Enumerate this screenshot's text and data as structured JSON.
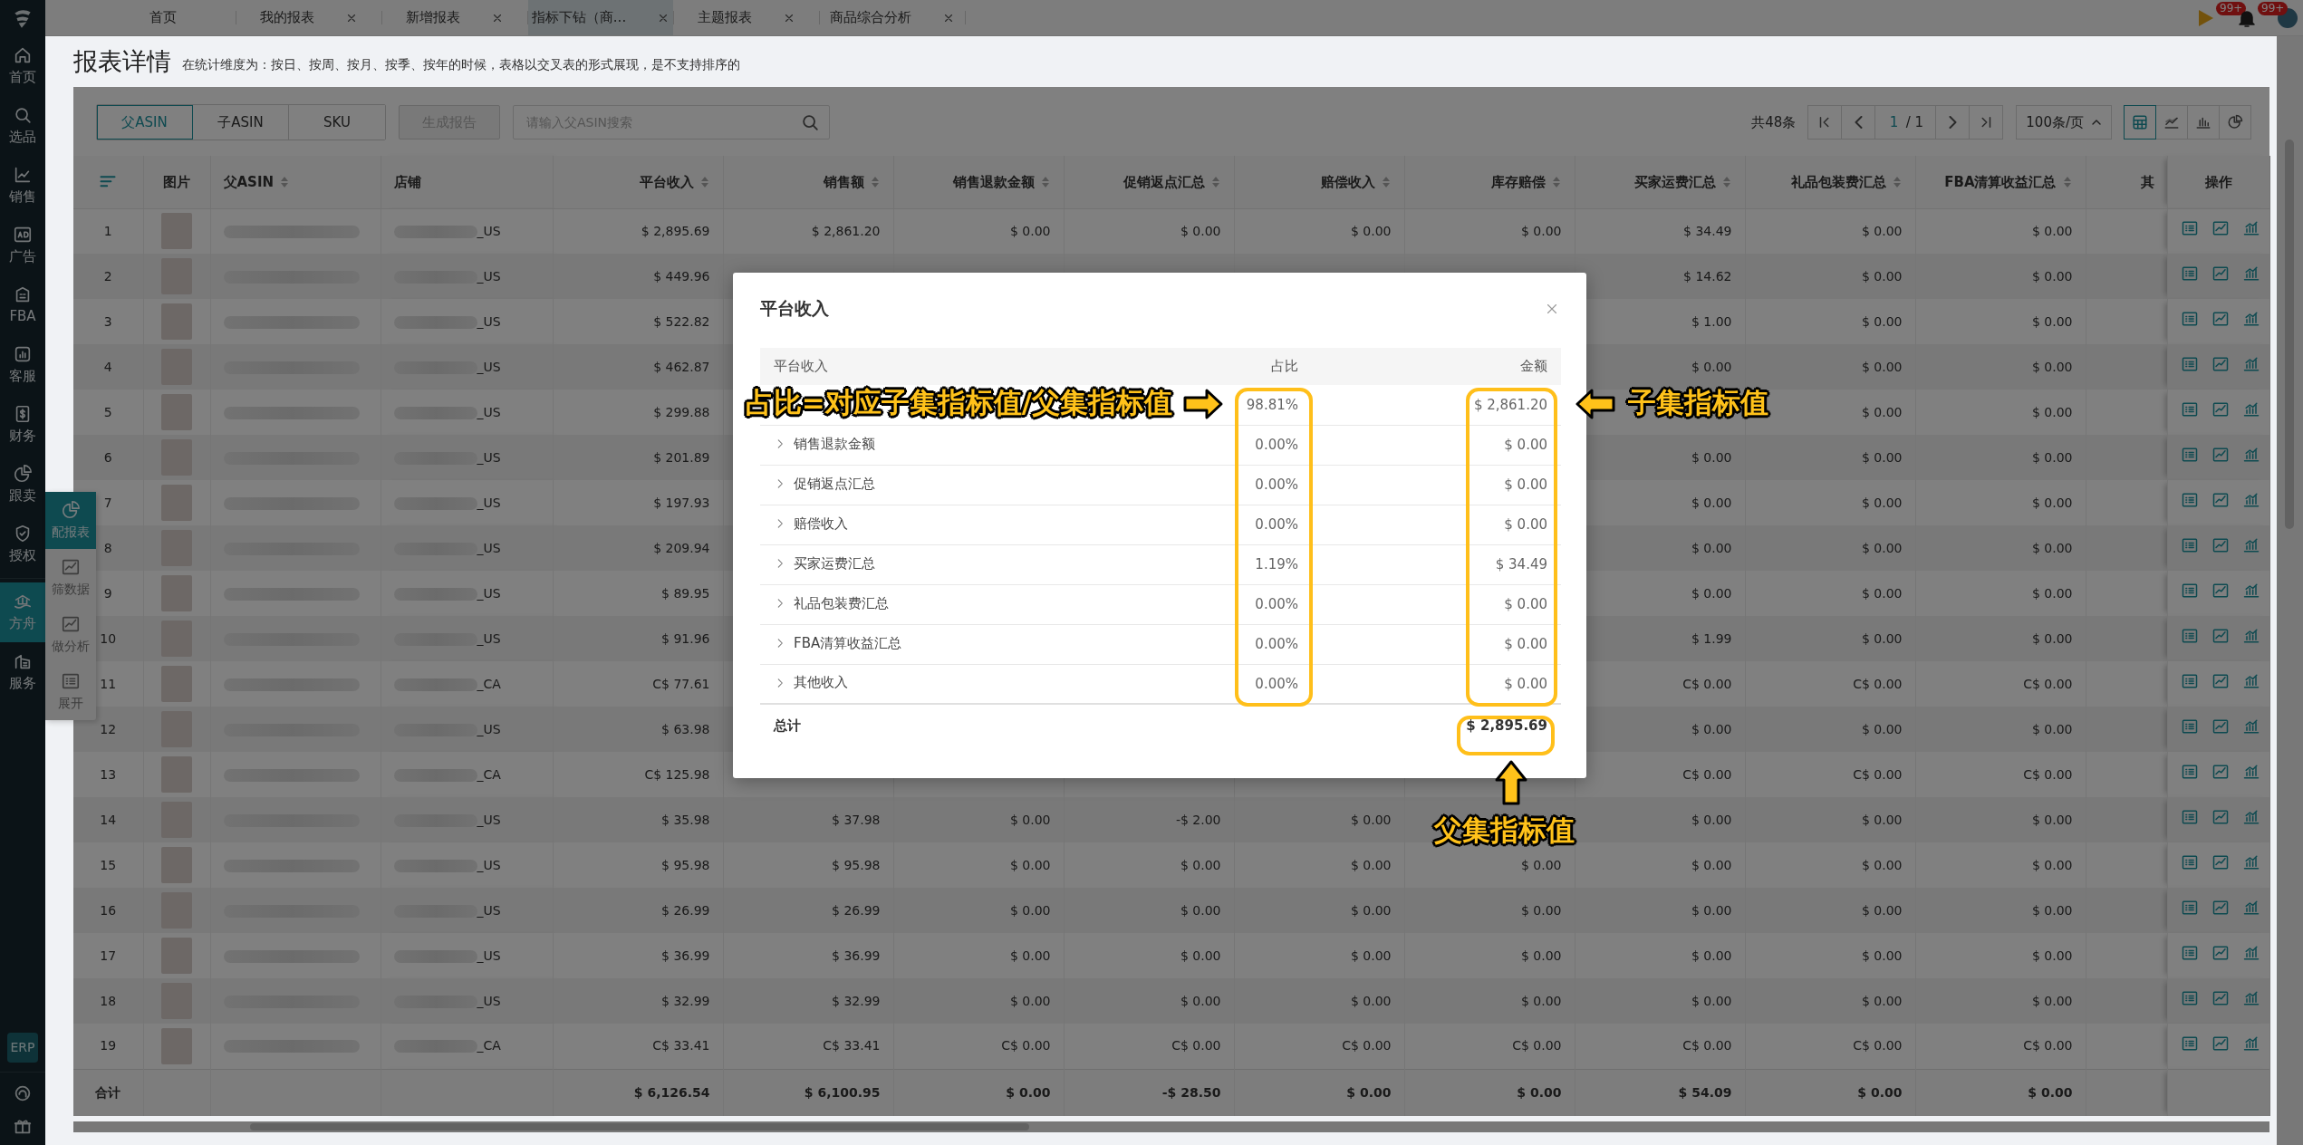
{
  "sidebar": {
    "items": [
      {
        "label": "首页",
        "selected": false
      },
      {
        "label": "选品",
        "selected": false
      },
      {
        "label": "销售",
        "selected": false
      },
      {
        "label": "广告",
        "selected": false
      },
      {
        "label": "FBA",
        "selected": false
      },
      {
        "label": "客服",
        "selected": false
      },
      {
        "label": "财务",
        "selected": false
      },
      {
        "label": "跟卖",
        "selected": false
      },
      {
        "label": "授权",
        "selected": false
      },
      {
        "label": "方舟",
        "selected": true
      },
      {
        "label": "服务",
        "selected": false
      }
    ],
    "badge": "ERP"
  },
  "flyout": {
    "items": [
      {
        "label": "配报表",
        "selected": true
      },
      {
        "label": "筛数据",
        "selected": false
      },
      {
        "label": "做分析",
        "selected": false
      },
      {
        "label": "展开",
        "selected": false
      }
    ]
  },
  "tabs": [
    {
      "label": "首页",
      "closable": false,
      "selected": false
    },
    {
      "label": "我的报表",
      "closable": true,
      "selected": false
    },
    {
      "label": "新增报表",
      "closable": true,
      "selected": false
    },
    {
      "label": "指标下钻（商...",
      "closable": true,
      "selected": true
    },
    {
      "label": "主题报表",
      "closable": true,
      "selected": false
    },
    {
      "label": "商品综合分析",
      "closable": true,
      "selected": false
    }
  ],
  "notifications": [
    {
      "kind": "flag",
      "count": "99+"
    },
    {
      "kind": "bell",
      "count": "99+"
    }
  ],
  "page": {
    "title": "报表详情",
    "hint": "在统计维度为：按日、按周、按月、按季、按年的时候，表格以交叉表的形式展现，是不支持排序的"
  },
  "toolbar": {
    "segments": [
      {
        "label": "父ASIN",
        "selected": true
      },
      {
        "label": "子ASIN",
        "selected": false
      },
      {
        "label": "SKU",
        "selected": false
      }
    ],
    "generate_button": {
      "label": "生成报告",
      "disabled": true
    },
    "search": {
      "placeholder": "请输入父ASIN搜索"
    }
  },
  "pagination": {
    "total": "共48条",
    "page": "1",
    "pages": "/ 1",
    "page_size": "100条/页"
  },
  "views": [
    {
      "kind": "table",
      "selected": true
    },
    {
      "kind": "line",
      "selected": false
    },
    {
      "kind": "bar",
      "selected": false
    },
    {
      "kind": "pie",
      "selected": false
    }
  ],
  "table": {
    "columns": [
      {
        "label": "图片",
        "kind": "image",
        "sortable": false
      },
      {
        "label": "父ASIN",
        "kind": "text",
        "sortable": true
      },
      {
        "label": "店铺",
        "kind": "shop",
        "sortable": false
      },
      {
        "label": "平台收入",
        "kind": "money",
        "sortable": true
      },
      {
        "label": "销售额",
        "kind": "money",
        "sortable": true
      },
      {
        "label": "销售退款金额",
        "kind": "money",
        "sortable": true
      },
      {
        "label": "促销返点汇总",
        "kind": "money",
        "sortable": true
      },
      {
        "label": "赔偿收入",
        "kind": "money",
        "sortable": true
      },
      {
        "label": "库存赔偿",
        "kind": "money",
        "sortable": true
      },
      {
        "label": "买家运费汇总",
        "kind": "money",
        "sortable": true
      },
      {
        "label": "礼品包装费汇总",
        "kind": "money",
        "sortable": true
      },
      {
        "label": "FBA清算收益汇总",
        "kind": "money",
        "sortable": true
      },
      {
        "label": "其",
        "kind": "cut",
        "sortable": false
      },
      {
        "label": "操作",
        "kind": "actions",
        "sortable": false
      }
    ],
    "rows": [
      {
        "index": "1",
        "market": "_US",
        "cells": {
          "platform_income": "$ 2,895.69",
          "sales": "$ 2,861.20",
          "refund": "$ 0.00",
          "promo_rebate": "$ 0.00",
          "compensation": "$ 0.00",
          "inventory_comp": "$ 0.00",
          "buyer_shipping": "$ 34.49",
          "gift_wrap": "$ 0.00",
          "fba_liquidation": "$ 0.00"
        }
      },
      {
        "index": "2",
        "market": "_US",
        "cells": {
          "platform_income": "$ 449.96",
          "buyer_shipping": "$ 14.62",
          "gift_wrap": "$ 0.00",
          "fba_liquidation": "$ 0.00"
        }
      },
      {
        "index": "3",
        "market": "_US",
        "cells": {
          "platform_income": "$ 522.82",
          "buyer_shipping": "$ 1.00",
          "gift_wrap": "$ 0.00",
          "fba_liquidation": "$ 0.00"
        }
      },
      {
        "index": "4",
        "market": "_US",
        "cells": {
          "platform_income": "$ 462.87",
          "buyer_shipping": "$ 0.00",
          "gift_wrap": "$ 0.00",
          "fba_liquidation": "$ 0.00"
        }
      },
      {
        "index": "5",
        "market": "_US",
        "cells": {
          "platform_income": "$ 299.88",
          "gift_wrap": "$ 0.00",
          "fba_liquidation": "$ 0.00"
        }
      },
      {
        "index": "6",
        "market": "_US",
        "cells": {
          "platform_income": "$ 201.89",
          "buyer_shipping": "$ 0.00",
          "gift_wrap": "$ 0.00",
          "fba_liquidation": "$ 0.00"
        }
      },
      {
        "index": "7",
        "market": "_US",
        "cells": {
          "platform_income": "$ 197.93",
          "buyer_shipping": "$ 0.00",
          "gift_wrap": "$ 0.00",
          "fba_liquidation": "$ 0.00"
        }
      },
      {
        "index": "8",
        "market": "_US",
        "cells": {
          "platform_income": "$ 209.94",
          "buyer_shipping": "$ 0.00",
          "gift_wrap": "$ 0.00",
          "fba_liquidation": "$ 0.00"
        }
      },
      {
        "index": "9",
        "market": "_US",
        "cells": {
          "platform_income": "$ 89.95",
          "buyer_shipping": "$ 0.00",
          "gift_wrap": "$ 0.00",
          "fba_liquidation": "$ 0.00"
        }
      },
      {
        "index": "10",
        "market": "_US",
        "cells": {
          "platform_income": "$ 91.96",
          "buyer_shipping": "$ 1.99",
          "gift_wrap": "$ 0.00",
          "fba_liquidation": "$ 0.00"
        }
      },
      {
        "index": "11",
        "market": "_CA",
        "cells": {
          "platform_income": "C$ 77.61",
          "buyer_shipping": "C$ 0.00",
          "gift_wrap": "C$ 0.00",
          "fba_liquidation": "C$ 0.00"
        }
      },
      {
        "index": "12",
        "market": "_US",
        "cells": {
          "platform_income": "$ 63.98",
          "buyer_shipping": "$ 0.00",
          "gift_wrap": "$ 0.00",
          "fba_liquidation": "$ 0.00"
        }
      },
      {
        "index": "13",
        "market": "_CA",
        "cells": {
          "platform_income": "C$ 125.98",
          "buyer_shipping": "C$ 0.00",
          "gift_wrap": "C$ 0.00",
          "fba_liquidation": "C$ 0.00"
        }
      },
      {
        "index": "14",
        "market": "_US",
        "cells": {
          "platform_income": "$ 35.98",
          "sales": "$ 37.98",
          "refund": "$ 0.00",
          "promo_rebate": "-$ 2.00",
          "compensation": "$ 0.00",
          "buyer_shipping": "$ 0.00",
          "gift_wrap": "$ 0.00",
          "fba_liquidation": "$ 0.00"
        }
      },
      {
        "index": "15",
        "market": "_US",
        "cells": {
          "platform_income": "$ 95.98",
          "sales": "$ 95.98",
          "refund": "$ 0.00",
          "promo_rebate": "$ 0.00",
          "compensation": "$ 0.00",
          "inventory_comp": "$ 0.00",
          "buyer_shipping": "$ 0.00",
          "gift_wrap": "$ 0.00",
          "fba_liquidation": "$ 0.00"
        }
      },
      {
        "index": "16",
        "market": "_US",
        "cells": {
          "platform_income": "$ 26.99",
          "sales": "$ 26.99",
          "refund": "$ 0.00",
          "promo_rebate": "$ 0.00",
          "compensation": "$ 0.00",
          "inventory_comp": "$ 0.00",
          "buyer_shipping": "$ 0.00",
          "gift_wrap": "$ 0.00",
          "fba_liquidation": "$ 0.00"
        }
      },
      {
        "index": "17",
        "market": "_US",
        "cells": {
          "platform_income": "$ 36.99",
          "sales": "$ 36.99",
          "refund": "$ 0.00",
          "promo_rebate": "$ 0.00",
          "compensation": "$ 0.00",
          "inventory_comp": "$ 0.00",
          "buyer_shipping": "$ 0.00",
          "gift_wrap": "$ 0.00",
          "fba_liquidation": "$ 0.00"
        }
      },
      {
        "index": "18",
        "market": "_US",
        "cells": {
          "platform_income": "$ 32.99",
          "sales": "$ 32.99",
          "refund": "$ 0.00",
          "promo_rebate": "$ 0.00",
          "compensation": "$ 0.00",
          "inventory_comp": "$ 0.00",
          "buyer_shipping": "$ 0.00",
          "gift_wrap": "$ 0.00",
          "fba_liquidation": "$ 0.00"
        }
      },
      {
        "index": "19",
        "market": "_CA",
        "cells": {
          "platform_income": "C$ 33.41",
          "sales": "C$ 33.41",
          "refund": "C$ 0.00",
          "promo_rebate": "C$ 0.00",
          "compensation": "C$ 0.00",
          "inventory_comp": "C$ 0.00",
          "buyer_shipping": "C$ 0.00",
          "gift_wrap": "C$ 0.00",
          "fba_liquidation": "C$ 0.00"
        }
      }
    ],
    "total": {
      "label": "合计",
      "cells": {
        "platform_income": "$ 6,126.54",
        "sales": "$ 6,100.95",
        "refund": "$ 0.00",
        "promo_rebate": "-$ 28.50",
        "compensation": "$ 0.00",
        "inventory_comp": "$ 0.00",
        "buyer_shipping": "$ 54.09",
        "gift_wrap": "$ 0.00",
        "fba_liquidation": "$ 0.00"
      }
    }
  },
  "modal": {
    "title": "平台收入",
    "columns": [
      "平台收入",
      "占比",
      "金额"
    ],
    "rows": [
      {
        "expandable": false,
        "share": "98.81%",
        "amount": "$ 2,861.20"
      },
      {
        "label": "销售退款金额",
        "expandable": true,
        "share": "0.00%",
        "amount": "$ 0.00"
      },
      {
        "label": "促销返点汇总",
        "expandable": true,
        "share": "0.00%",
        "amount": "$ 0.00"
      },
      {
        "label": "赔偿收入",
        "expandable": true,
        "share": "0.00%",
        "amount": "$ 0.00"
      },
      {
        "label": "买家运费汇总",
        "expandable": true,
        "share": "1.19%",
        "amount": "$ 34.49"
      },
      {
        "label": "礼品包装费汇总",
        "expandable": true,
        "share": "0.00%",
        "amount": "$ 0.00"
      },
      {
        "label": "FBA清算收益汇总",
        "expandable": true,
        "share": "0.00%",
        "amount": "$ 0.00"
      },
      {
        "label": "其他收入",
        "expandable": true,
        "share": "0.00%",
        "amount": "$ 0.00"
      }
    ],
    "total": {
      "label": "总计",
      "amount": "$ 2,895.69"
    }
  },
  "annotations": [
    {
      "text": "占比=对应子集指标值/父集指标值",
      "kind": "right-arrow"
    },
    {
      "text": "子集指标值",
      "kind": "left-arrow"
    },
    {
      "text": "父集指标值",
      "kind": "up-arrow"
    }
  ]
}
